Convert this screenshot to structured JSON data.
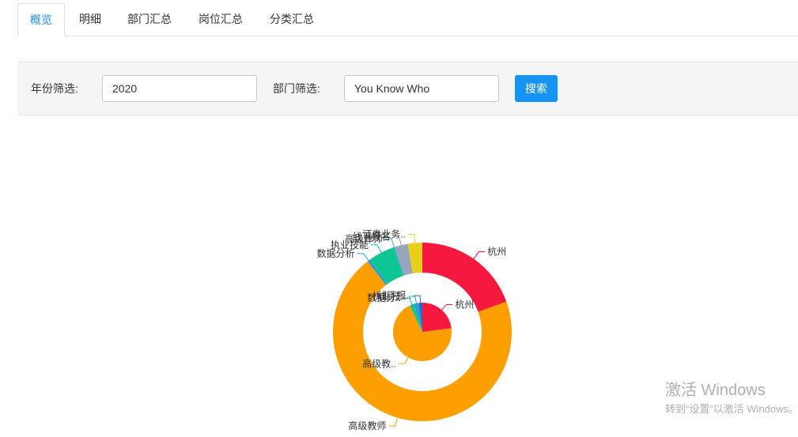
{
  "tabs": [
    {
      "label": "概览",
      "active": true
    },
    {
      "label": "明细",
      "active": false
    },
    {
      "label": "部门汇总",
      "active": false
    },
    {
      "label": "岗位汇总",
      "active": false
    },
    {
      "label": "分类汇总",
      "active": false
    }
  ],
  "filters": {
    "year_label": "年份筛选:",
    "year_value": "2020",
    "dept_label": "部门筛选:",
    "dept_value": "You Know Who",
    "search_label": "搜索"
  },
  "chart_data": [
    {
      "type": "pie",
      "ring": "outer",
      "slices": [
        {
          "name": "杭州",
          "value": 19.5,
          "color": "#f5193f"
        },
        {
          "name": "高级教师",
          "value": 70.0,
          "color": "#fd9f00"
        },
        {
          "name": "数据分析",
          "value": 0.5,
          "color": "#2e9bd6"
        },
        {
          "name": "执业技能",
          "value": 4.8,
          "color": "#0ec694"
        },
        {
          "name": "高级律师",
          "value": 0.2,
          "color": "#3ba0e0"
        },
        {
          "name": "线下报名",
          "value": 2.4,
          "color": "#98a6b9"
        },
        {
          "name": "证券业务..",
          "value": 2.6,
          "color": "#e8cf1b"
        }
      ]
    },
    {
      "type": "pie",
      "ring": "inner",
      "slices": [
        {
          "name": "杭州",
          "value": 23.0,
          "color": "#f5193f"
        },
        {
          "name": "高级教..",
          "value": 70.0,
          "color": "#fd9f00"
        },
        {
          "name": "数据分..",
          "value": 2.5,
          "color": "#0ec694"
        },
        {
          "name": "执业技..",
          "value": 2.5,
          "color": "#2e9bd6"
        },
        {
          "name": "线下报..",
          "value": 2.0,
          "color": "#1a6fc9"
        }
      ]
    }
  ],
  "watermark": {
    "title": "激活 Windows",
    "subtitle": "转到“设置”以激活 Windows。"
  }
}
